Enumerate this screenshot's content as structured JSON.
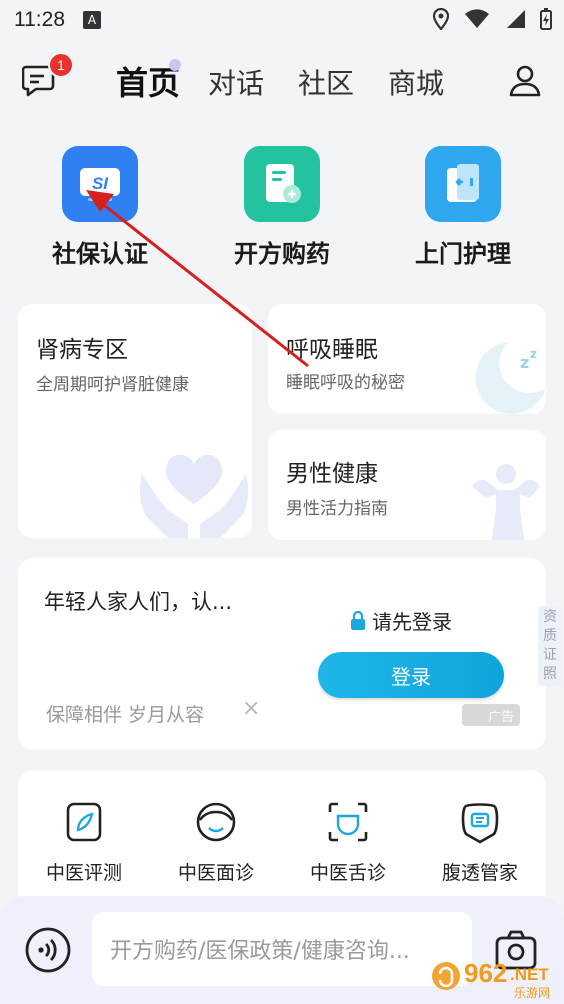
{
  "status_bar": {
    "time": "11:28",
    "a_badge": "A"
  },
  "nav": {
    "message_badge": "1",
    "tabs": [
      {
        "label": "首页"
      },
      {
        "label": "对话"
      },
      {
        "label": "社区"
      },
      {
        "label": "商城"
      }
    ]
  },
  "quick_actions": [
    {
      "label": "社保认证",
      "icon": "social-security-icon",
      "color": "#2f80f0",
      "icon_text": "SI"
    },
    {
      "label": "开方购药",
      "icon": "prescription-icon",
      "color": "#23c3a0"
    },
    {
      "label": "上门护理",
      "icon": "home-care-icon",
      "color": "#2ea7f0"
    }
  ],
  "feature_cards": [
    {
      "title": "肾病专区",
      "subtitle": "全周期呵护肾脏健康"
    },
    {
      "title": "呼吸睡眠",
      "subtitle": "睡眠呼吸的秘密"
    },
    {
      "title": "男性健康",
      "subtitle": "男性活力指南"
    }
  ],
  "ad": {
    "title": "年轻人家人们，认...",
    "subtitle": "保障相伴 岁月从容",
    "close": "×",
    "login_prompt": "请先登录",
    "login_button": "登录",
    "ad_tag": "广告"
  },
  "side_tag": [
    "资",
    "质",
    "证",
    "照"
  ],
  "tools": [
    {
      "label": "中医评测",
      "icon": "tcm-assessment-icon"
    },
    {
      "label": "中医面诊",
      "icon": "face-diagnosis-icon"
    },
    {
      "label": "中医舌诊",
      "icon": "tongue-diagnosis-icon"
    },
    {
      "label": "腹透管家",
      "icon": "dialysis-manager-icon"
    }
  ],
  "search": {
    "placeholder": "开方购药/医保政策/健康咨询..."
  },
  "watermark": {
    "text1": "962",
    "text2": ".NET",
    "text3": "乐游网"
  },
  "colors": {
    "accent": "#10a4dc",
    "badge": "#e8322a",
    "arrow": "#d62020"
  }
}
